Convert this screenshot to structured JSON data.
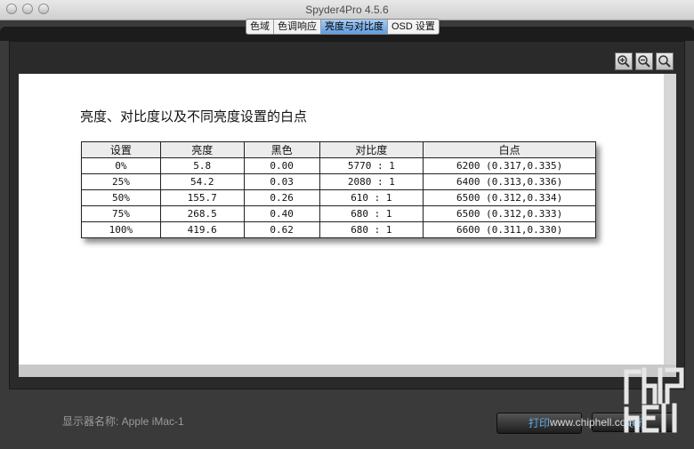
{
  "window": {
    "title": "Spyder4Pro 4.5.6"
  },
  "tabs": [
    {
      "label": "色域",
      "active": false
    },
    {
      "label": "色调响应",
      "active": false
    },
    {
      "label": "亮度与对比度",
      "active": true
    },
    {
      "label": "OSD 设置",
      "active": false
    }
  ],
  "zoom_controls": [
    "zoom-in-icon",
    "zoom-out-icon",
    "zoom-fit-icon"
  ],
  "report": {
    "heading": "亮度、对比度以及不同亮度设置的白点",
    "columns": [
      "设置",
      "亮度",
      "黑色",
      "对比度",
      "白点"
    ],
    "rows": [
      [
        "0%",
        "5.8",
        "0.00",
        "5770 : 1",
        "6200 (0.317,0.335)"
      ],
      [
        "25%",
        "54.2",
        "0.03",
        "2080 : 1",
        "6400 (0.313,0.336)"
      ],
      [
        "50%",
        "155.7",
        "0.26",
        "610 : 1",
        "6500 (0.312,0.334)"
      ],
      [
        "75%",
        "268.5",
        "0.40",
        "680 : 1",
        "6500 (0.312,0.333)"
      ],
      [
        "100%",
        "419.6",
        "0.62",
        "680 : 1",
        "6600 (0.311,0.330)"
      ]
    ]
  },
  "footer": {
    "display_label": "显示器名称: Apple iMac-1",
    "print_label": "打印",
    "close_label": "关闭",
    "watermark": "www.chiphell.com"
  },
  "colors": {
    "accent": "#5aa9e6",
    "tab_active": "#7fb3ea",
    "background": "#3a3a3a"
  }
}
